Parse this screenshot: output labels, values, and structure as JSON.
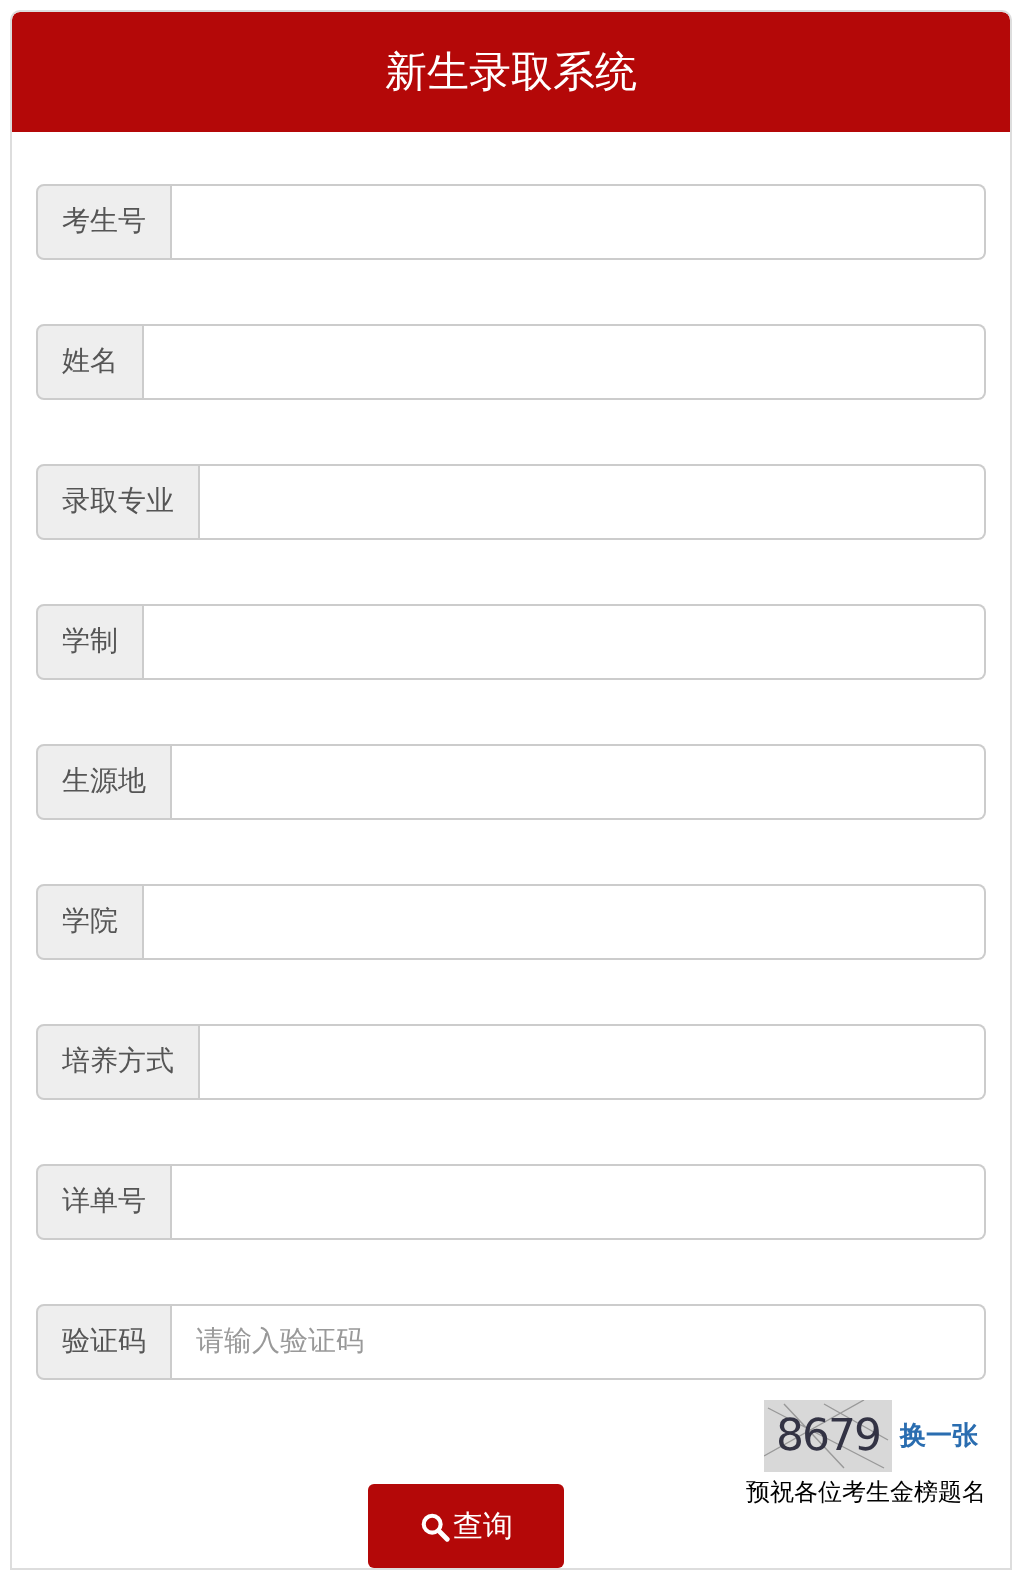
{
  "header": {
    "title": "新生录取系统"
  },
  "fields": [
    {
      "label": "考生号"
    },
    {
      "label": "姓名"
    },
    {
      "label": "录取专业"
    },
    {
      "label": "学制"
    },
    {
      "label": "生源地"
    },
    {
      "label": "学院"
    },
    {
      "label": "培养方式"
    },
    {
      "label": "详单号"
    },
    {
      "label": "验证码",
      "placeholder": "请输入验证码"
    }
  ],
  "captcha": {
    "code": "8679",
    "refresh_link": "换一张"
  },
  "note": "预祝各位考生金榜题名",
  "submit_button": {
    "label": "查询"
  }
}
